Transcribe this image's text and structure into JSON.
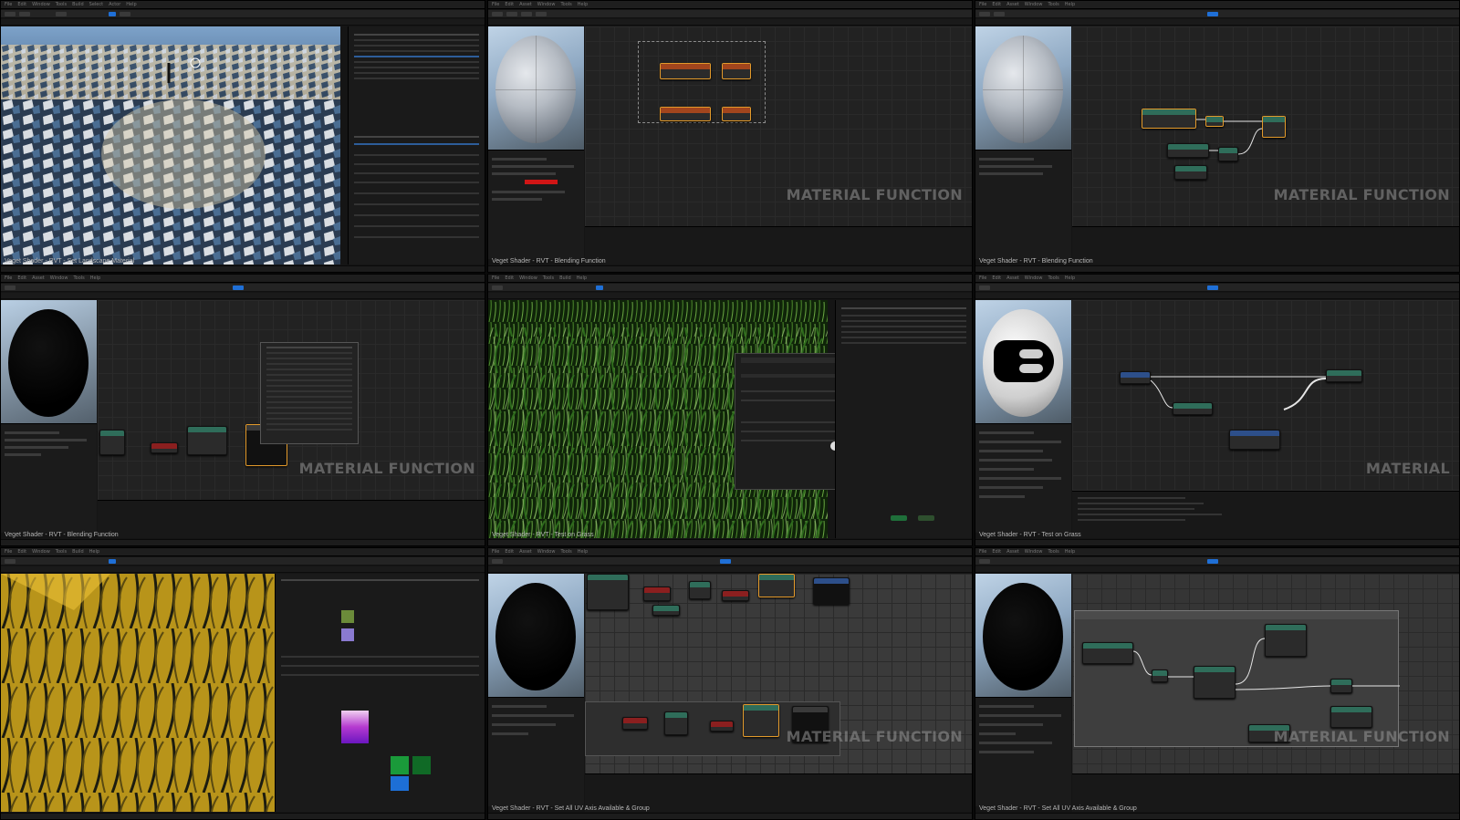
{
  "tiles": [
    {
      "id": "t1",
      "caption": "Veget Shader - RVT - Set Landscape Material",
      "kind": "landscape-viewport",
      "watermark": ""
    },
    {
      "id": "t2",
      "caption": "Veget Shader - RVT - Blending Function",
      "kind": "material-graph",
      "watermark": "MATERIAL FUNCTION"
    },
    {
      "id": "t3",
      "caption": "Veget Shader - RVT - Blending Function",
      "kind": "material-graph",
      "watermark": "MATERIAL FUNCTION"
    },
    {
      "id": "t4",
      "caption": "Veget Shader - RVT - Blending Function",
      "kind": "material-graph",
      "watermark": "MATERIAL FUNCTION"
    },
    {
      "id": "t5",
      "caption": "Veget Shader - RVT - Test on Grass",
      "kind": "grass-viewport",
      "watermark": ""
    },
    {
      "id": "t6",
      "caption": "Veget Shader - RVT - Test on Grass",
      "kind": "material-graph",
      "watermark": "MATERIAL"
    },
    {
      "id": "t7",
      "caption": "",
      "kind": "grass-closeup",
      "watermark": ""
    },
    {
      "id": "t8",
      "caption": "Veget Shader - RVT - Set All UV Axis Available & Group",
      "kind": "material-graph",
      "watermark": "MATERIAL FUNCTION"
    },
    {
      "id": "t9",
      "caption": "Veget Shader - RVT - Set All UV Axis Available & Group",
      "kind": "material-graph",
      "watermark": "MATERIAL FUNCTION"
    }
  ],
  "icons": {
    "play": "play-icon",
    "settings": "gear-icon"
  },
  "colors": {
    "selection": "#e39a2b",
    "accent_blue": "#1f6fd6",
    "wire": "#e6e6e6",
    "red_param": "#d01515"
  }
}
